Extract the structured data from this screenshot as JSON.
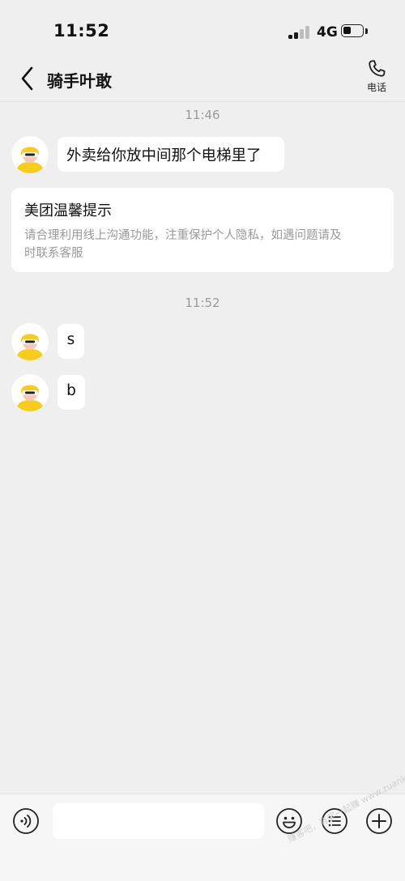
{
  "status_bar": {
    "time": "11:52",
    "network": "4G"
  },
  "header": {
    "title": "骑手叶敢",
    "call_label": "电话"
  },
  "chat": {
    "timestamp_1": "11:46",
    "message_1": "外卖给你放中间那个电梯里了",
    "notice_title": "美团温馨提示",
    "notice_body_line1": "请合理利用线上沟通功能，注重保护个人隐私，如遇问题请及",
    "notice_body_line2": "时联系客服",
    "timestamp_2": "11:52",
    "message_2": "s",
    "message_3": "b"
  },
  "input": {
    "value": ""
  },
  "watermark": "赚客吧，有奖一起赚 www.zuanke8.com",
  "colors": {
    "background": "#efefef",
    "bubble": "#ffffff",
    "avatar_yellow": "#f7cc1a",
    "timestamp": "#9a9a9a"
  },
  "icons": [
    "back-chevron-icon",
    "phone-icon",
    "voice-icon",
    "emoji-icon",
    "menu-list-icon",
    "plus-icon",
    "rider-avatar"
  ]
}
